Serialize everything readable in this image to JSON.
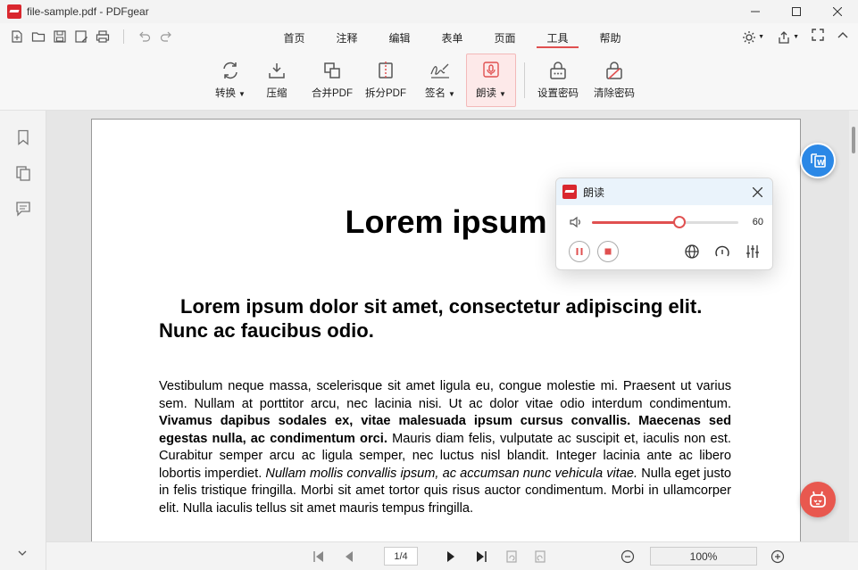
{
  "window": {
    "title": "file-sample.pdf - PDFgear",
    "controls": [
      "minimize-icon",
      "maximize-icon",
      "close-icon"
    ]
  },
  "quick_toolbar": [
    "new-file-icon",
    "open-folder-icon",
    "save-icon",
    "save-as-icon",
    "print-icon",
    "undo-icon",
    "redo-icon"
  ],
  "tabs": [
    {
      "label": "首页"
    },
    {
      "label": "注释"
    },
    {
      "label": "编辑"
    },
    {
      "label": "表单"
    },
    {
      "label": "页面"
    },
    {
      "label": "工具",
      "active": true
    },
    {
      "label": "帮助"
    }
  ],
  "ribbon": {
    "convert": "转换",
    "compress": "压缩",
    "merge": "合并PDF",
    "split": "拆分PDF",
    "sign": "签名",
    "read_aloud": "朗读",
    "set_password": "设置密码",
    "remove_password": "清除密码"
  },
  "document": {
    "heading": "Lorem ipsum",
    "subheading": "Lorem ipsum dolor sit amet, consectetur adipiscing elit. Nunc ac faucibus odio.",
    "para_1": "Vestibulum neque massa, scelerisque sit amet ligula eu, congue molestie mi. Praesent ut varius sem. Nullam at porttitor arcu, nec lacinia nisi. Ut ac dolor vitae odio interdum condimentum.",
    "para_bold": "Vivamus dapibus sodales ex, vitae malesuada ipsum cursus convallis. Maecenas sed egestas nulla, ac condimentum orci.",
    "para_2": "Mauris diam felis, vulputate ac suscipit et, iaculis non est. Curabitur semper arcu ac ligula semper, nec luctus nisl blandit. Integer lacinia ante ac libero lobortis imperdiet.",
    "para_italic": "Nullam mollis convallis ipsum, ac accumsan nunc vehicula vitae.",
    "para_3": "Nulla eget justo in felis tristique fringilla. Morbi sit amet tortor quis risus auctor condimentum. Morbi in ullamcorper elit. Nulla iaculis tellus sit amet mauris tempus fringilla."
  },
  "read_aloud": {
    "title": "朗读",
    "volume": 60,
    "volume_label": "60"
  },
  "bottom": {
    "page_indicator": "1/4",
    "zoom": "100%"
  },
  "colors": {
    "accent": "#e05050",
    "brand": "#d9272e",
    "convert_fab": "#2b88e6",
    "ai_fab": "#e8584f"
  }
}
